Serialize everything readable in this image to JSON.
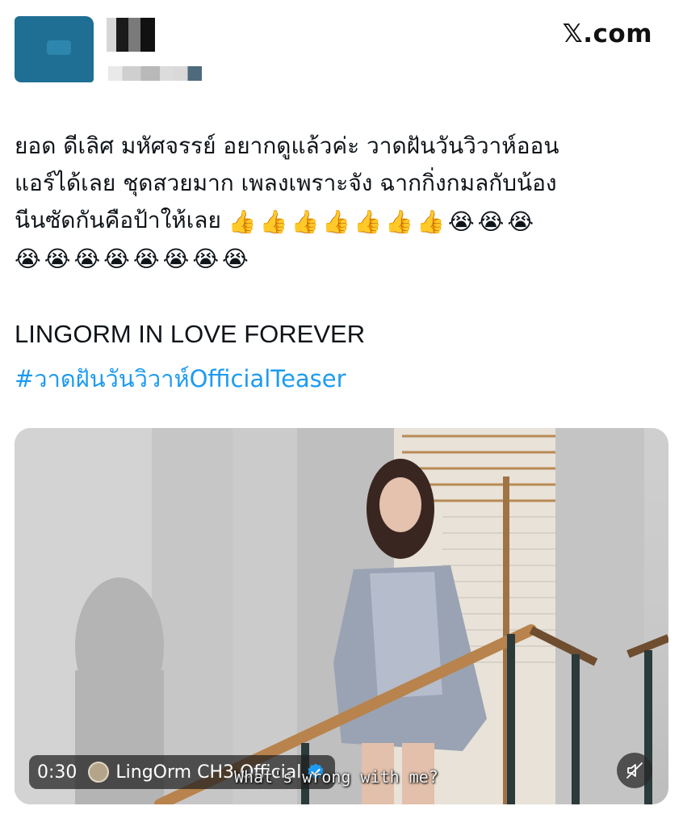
{
  "header": {
    "site_logo": "𝕏.com"
  },
  "post": {
    "text_line1": "ยอด ดีเลิศ มหัศจรรย์ อยากดูแล้วค่ะ วาดฝันวันวิวาห์ออน",
    "text_line2": "แอร์ได้เลย ชุดสวยมาก เพลงเพราะจัง ฉากกิ่งกมลกับน้อง",
    "text_line3": "นีนซัดกันคือป้าให้เลย",
    "emojis_line3": [
      "👍",
      "👍",
      "👍",
      "👍",
      "👍",
      "👍",
      "👍",
      "😭",
      "😭",
      "😭"
    ],
    "emojis_line4": [
      "😭",
      "😭",
      "😭",
      "😭",
      "😭",
      "😭",
      "😭",
      "😭"
    ],
    "tagline": "LINGORM IN LOVE FOREVER",
    "hashtag": "#วาดฝันวันวิวาห์OfficialTeaser"
  },
  "video": {
    "duration": "0:30",
    "channel_name": "LingOrm CH3 Official",
    "subtitle": "What's wrong with me?",
    "icons": {
      "verified": "verified-badge-icon",
      "mute": "muted-speaker-icon"
    },
    "colors": {
      "verified": "#1d9bf0",
      "link": "#1d9bf0"
    }
  }
}
